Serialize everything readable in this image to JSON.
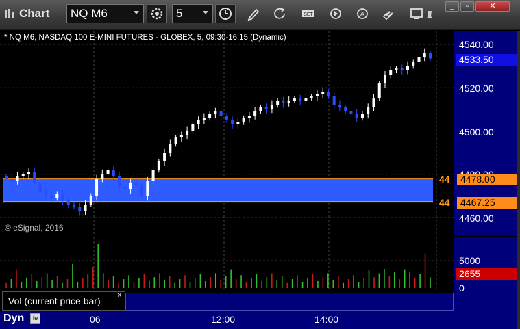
{
  "window": {
    "title": "Chart",
    "symbol": "NQ M6",
    "interval": "5",
    "buttons": {
      "minimize": "_",
      "restore": "▫",
      "close": "✕"
    }
  },
  "toolbar": {
    "icons": [
      "gear-icon",
      "clock-icon",
      "pencil-icon",
      "refresh-icon",
      "set-icon",
      "play-icon",
      "alert-icon",
      "link-icon",
      "display-icon",
      "pin-icon"
    ]
  },
  "chart": {
    "description": "* NQ M6, NASDAQ 100 E-MINI FUTURES - GLOBEX, 5, 09:30-16:15 (Dynamic)",
    "copyright": "© eSignal, 2016",
    "price_labels": [
      "4540.00",
      "4520.00",
      "4500.00",
      "4480.00",
      "4460.00"
    ],
    "last_price": "4533.50",
    "band_top_price": "4478.00",
    "band_bottom_price": "4467.25",
    "band_marker": "44",
    "volume_labels": [
      "5000",
      "0"
    ],
    "last_volume": "2655",
    "time_labels": [
      "06",
      "12:00",
      "14:00"
    ],
    "study": "Vol (current price bar)",
    "study_close": "×",
    "dyn_label": "Dyn",
    "dyn_icon": "fe"
  },
  "colors": {
    "up_candle": "#ffffff",
    "down_candle": "#2a4cff",
    "band_fill": "#2e5cff",
    "band_edge": "#ff9a1a",
    "last_price_bg": "#1010e0",
    "volume_bg": "#cc0000",
    "axis_bg": "#00007a"
  },
  "chart_data": {
    "type": "candlestick",
    "title": "NQ M6",
    "x": "5-minute bars, 06 (session start) through ~15:30",
    "ylim": [
      4455,
      4545
    ],
    "bands": [
      {
        "top": 4478.0,
        "bottom": 4467.25,
        "segments": 2
      }
    ],
    "last_price": 4533.5,
    "closes": [
      4478,
      4477,
      4479,
      4480,
      4481,
      4476,
      4472,
      4470,
      4469,
      4471,
      4468,
      4466,
      4465,
      4463,
      4466,
      4470,
      4478,
      4480,
      4482,
      4479,
      4474,
      4473,
      4476,
      4475,
      4470,
      4477,
      4482,
      4486,
      4490,
      4494,
      4497,
      4498,
      4500,
      4503,
      4505,
      4506,
      4508,
      4509,
      4507,
      4505,
      4503,
      4504,
      4506,
      4507,
      4509,
      4511,
      4510,
      4512,
      4514,
      4513,
      4514,
      4515,
      4514,
      4515,
      4516,
      4517,
      4518,
      4516,
      4512,
      4511,
      4509,
      4508,
      4506,
      4508,
      4511,
      4515,
      4522,
      4526,
      4528,
      4529,
      4528,
      4530,
      4532,
      4534,
      4536,
      4533.5
    ],
    "volume": {
      "ylim": [
        0,
        8000
      ],
      "last": 2655,
      "peaks": [
        4400,
        8000,
        3800,
        6300
      ]
    }
  }
}
